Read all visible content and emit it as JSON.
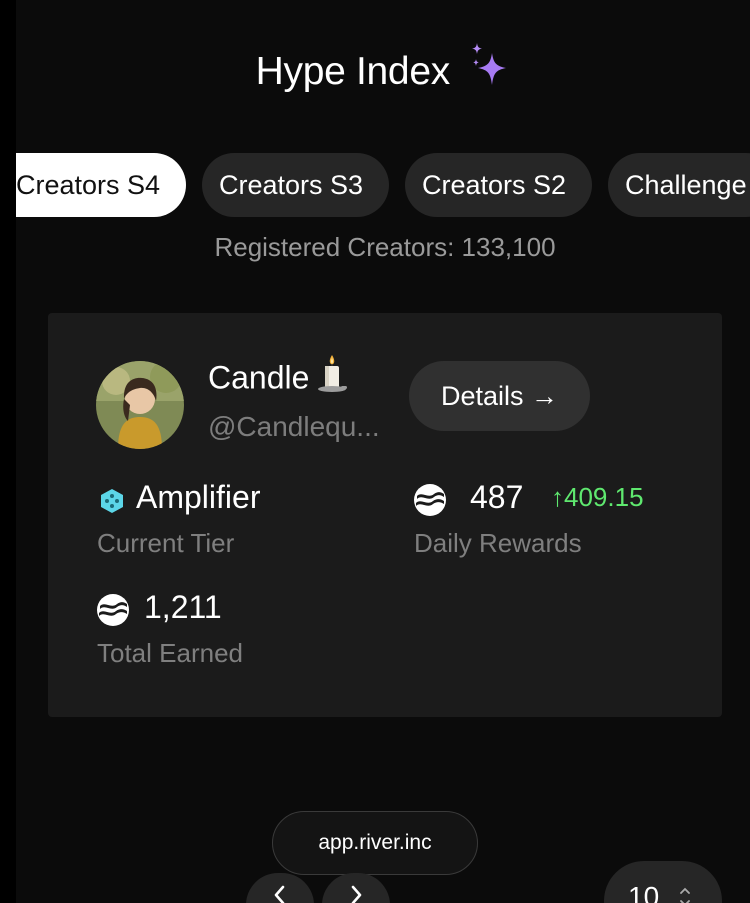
{
  "header": {
    "title": "Hype Index",
    "title_icon": "sparkles-icon"
  },
  "tabs": [
    {
      "label": "Creators S4",
      "active": true
    },
    {
      "label": "Creators S3",
      "active": false
    },
    {
      "label": "Creators S2",
      "active": false
    },
    {
      "label": "Challenge",
      "active": false
    }
  ],
  "registered_text": "Registered Creators: 133,100",
  "card": {
    "name": "Candle",
    "name_icon": "candle-icon",
    "handle": "@Candlequ...",
    "details_label": "Details →",
    "tier": {
      "value": "Amplifier",
      "label": "Current Tier",
      "icon": "tier-gem-icon"
    },
    "daily_rewards": {
      "value": "487",
      "change": "↑409.15",
      "label": "Daily Rewards",
      "icon": "river-token-icon"
    },
    "total_earned": {
      "value": "1,211",
      "label": "Total Earned",
      "icon": "river-token-icon"
    }
  },
  "footer": {
    "url": "app.river.inc",
    "prev_icon": "chevron-left-icon",
    "next_icon": "chevron-right-icon",
    "page_size": "10"
  },
  "colors": {
    "background": "#0b0b0b",
    "card": "#1b1b1b",
    "pill": "#262626",
    "positive": "#5fe86f",
    "muted": "#7f7f7f",
    "sparkle": "#a77bf3",
    "tier_icon": "#5cd6e8"
  }
}
